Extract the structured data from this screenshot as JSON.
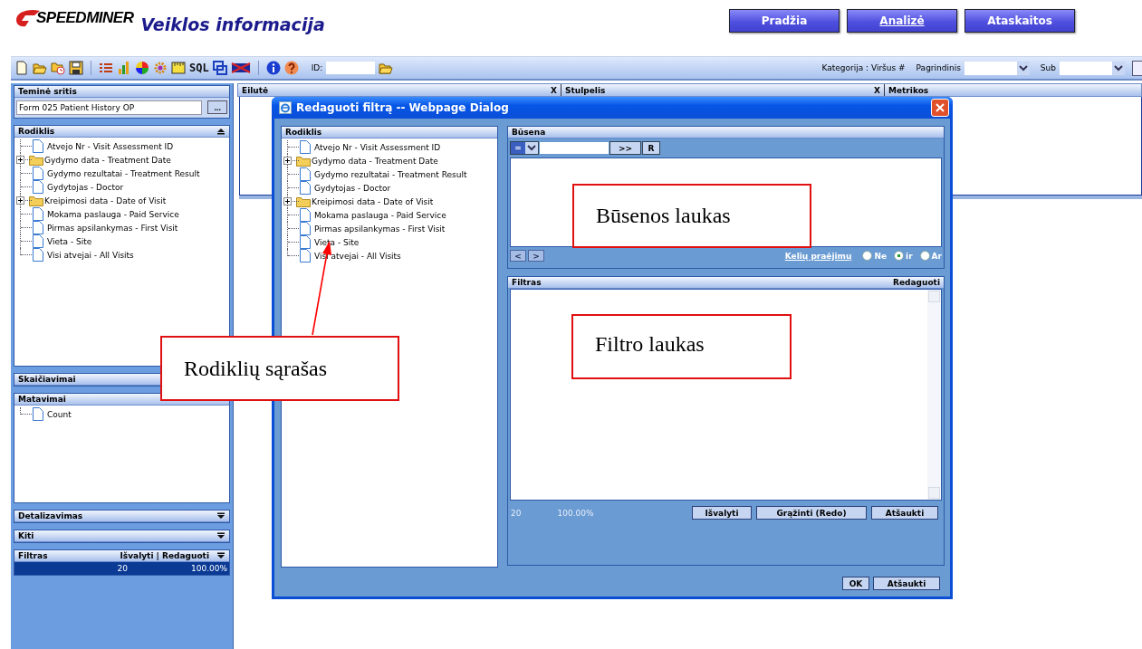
{
  "header": {
    "logo_text": "SPEEDMINER",
    "title": "Veiklos informacija",
    "nav": [
      {
        "label": "Pradžia",
        "selected": false
      },
      {
        "label": "Analizė",
        "selected": true
      },
      {
        "label": "Ataskaitos",
        "selected": false
      }
    ]
  },
  "toolbar": {
    "sql_label": "SQL",
    "id_label": "ID:",
    "category": "Kategorija : Viršus #",
    "primary_label": "Pagrindinis",
    "sub_label": "Sub"
  },
  "sidebar": {
    "subject": {
      "title": "Teminė sritis",
      "value": "Form 025 Patient History OP",
      "button": "..."
    },
    "indicators": {
      "title": "Rodiklis",
      "expanded": true,
      "items": [
        {
          "label": "Atvejo Nr - Visit Assessment ID",
          "kind": "file"
        },
        {
          "label": "Gydymo data - Treatment Date",
          "kind": "folder"
        },
        {
          "label": "Gydymo rezultatai - Treatment Result",
          "kind": "file"
        },
        {
          "label": "Gydytojas - Doctor",
          "kind": "file"
        },
        {
          "label": "Kreipimosi data - Date of Visit",
          "kind": "folder"
        },
        {
          "label": "Mokama paslauga - Paid Service",
          "kind": "file"
        },
        {
          "label": "Pirmas apsilankymas - First Visit",
          "kind": "file"
        },
        {
          "label": "Vieta - Site",
          "kind": "file"
        },
        {
          "label": "Visi atvejai - All Visits",
          "kind": "file"
        }
      ]
    },
    "calculations": {
      "title": "Skaičiavimai"
    },
    "measures": {
      "title": "Matavimai",
      "items": [
        {
          "label": "Count",
          "kind": "file"
        }
      ]
    },
    "drilldown": {
      "title": "Detalizavimas",
      "expanded": false
    },
    "other": {
      "title": "Kiti",
      "expanded": false
    },
    "filter": {
      "title": "Filtras",
      "actions": "Išvalyti | Redaguoti",
      "expanded": false,
      "count": "20",
      "percent": "100.00%"
    }
  },
  "grid": {
    "columns": [
      {
        "label": "Eilutė",
        "remove": "X"
      },
      {
        "label": "Stulpelis",
        "remove": "X"
      },
      {
        "label": "Metrikos"
      }
    ]
  },
  "dialog": {
    "title": "Redaguoti filtrą -- Webpage Dialog",
    "indicators": {
      "title": "Rodiklis",
      "items": [
        {
          "label": "Atvejo Nr - Visit Assessment ID",
          "kind": "file"
        },
        {
          "label": "Gydymo data - Treatment Date",
          "kind": "folder"
        },
        {
          "label": "Gydymo rezultatai - Treatment Result",
          "kind": "file"
        },
        {
          "label": "Gydytojas - Doctor",
          "kind": "file"
        },
        {
          "label": "Kreipimosi data - Date of Visit",
          "kind": "folder"
        },
        {
          "label": "Mokama paslauga - Paid Service",
          "kind": "file"
        },
        {
          "label": "Pirmas apsilankymas - First Visit",
          "kind": "file"
        },
        {
          "label": "Vieta - Site",
          "kind": "file"
        },
        {
          "label": "Visi atvejai - All Visits",
          "kind": "file"
        }
      ]
    },
    "status": {
      "title": "Būsena",
      "operator": "=",
      "add_button": ">>",
      "reset_button": "R",
      "prev_button": "<",
      "next_button": ">",
      "link": "Kelių praėjimų",
      "options": [
        {
          "label": "Ne",
          "selected": false
        },
        {
          "label": "ir",
          "selected": true
        },
        {
          "label": "Ar",
          "selected": false
        }
      ]
    },
    "filter": {
      "title": "Filtras",
      "action": "Redaguoti",
      "count": "20",
      "percent": "100.00%",
      "buttons": [
        "Išvalyti",
        "Grąžinti (Redo)",
        "Atšaukti"
      ]
    },
    "buttons": [
      "OK",
      "Atšaukti"
    ]
  },
  "annotations": [
    {
      "text": "Rodiklių sąrašas"
    },
    {
      "text": "Būsenos laukas"
    },
    {
      "text": "Filtro laukas"
    }
  ]
}
